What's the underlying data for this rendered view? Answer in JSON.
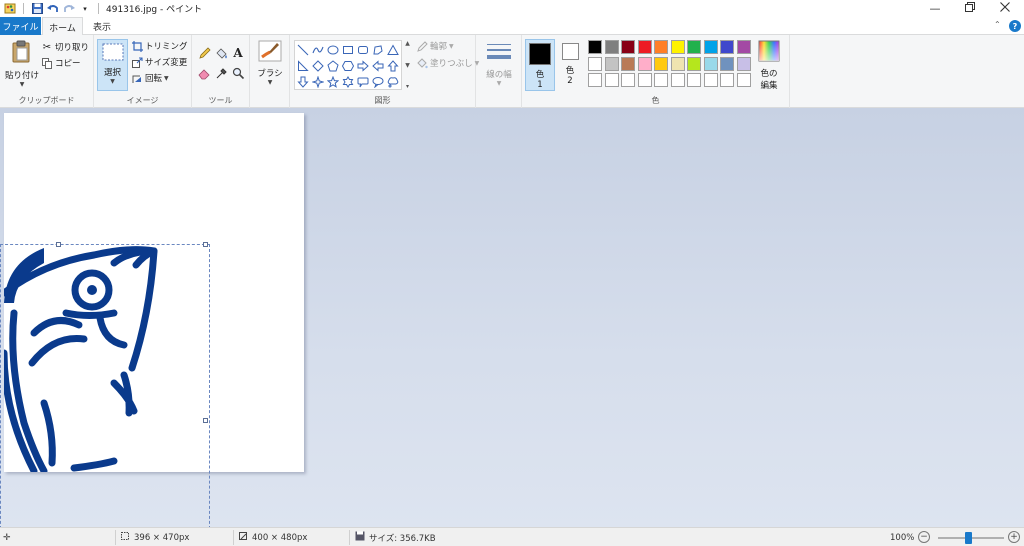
{
  "window": {
    "title": "491316.jpg - ペイント",
    "controls": {
      "minimize_icon": "minimize-icon",
      "restore_icon": "restore-icon",
      "close_icon": "close-icon"
    }
  },
  "tabs": [
    {
      "label": "ファイル",
      "selected": false
    },
    {
      "label": "ホーム",
      "selected": true
    },
    {
      "label": "表示",
      "selected": false
    }
  ],
  "ribbon": {
    "clipboard": {
      "paste": "貼り付け",
      "cut": "切り取り",
      "copy": "コピー",
      "label": "クリップボード"
    },
    "image": {
      "select": "選択",
      "crop": "トリミング",
      "resize": "サイズ変更",
      "rotate": "回転",
      "label": "イメージ"
    },
    "tools": {
      "label": "ツール"
    },
    "brush": {
      "label": "ブラシ"
    },
    "shapes": {
      "outline": "輪郭",
      "fill": "塗りつぶし",
      "label": "図形"
    },
    "size": {
      "label": "線の幅"
    },
    "colors": {
      "color1": "色",
      "color1_num": "1",
      "color2": "色",
      "color2_num": "2",
      "edit_line1": "色の",
      "edit_line2": "編集",
      "label": "色",
      "color1_value": "#000000",
      "color2_value": "#ffffff",
      "palette_row1": [
        "#000000",
        "#7f7f7f",
        "#880015",
        "#ed1c24",
        "#ff7f27",
        "#fff200",
        "#22b14c",
        "#00a2e8",
        "#3f48cc",
        "#a349a4"
      ],
      "palette_row2": [
        "#ffffff",
        "#c3c3c3",
        "#b97a57",
        "#ffaec9",
        "#ffc90e",
        "#efe4b0",
        "#b5e61d",
        "#99d9ea",
        "#7092be",
        "#c8bfe7"
      ],
      "palette_row3": [
        "#ffffff",
        "#ffffff",
        "#ffffff",
        "#ffffff",
        "#ffffff",
        "#ffffff",
        "#ffffff",
        "#ffffff",
        "#ffffff",
        "#ffffff"
      ]
    }
  },
  "canvas": {
    "artwork_color": "#0a3a8c"
  },
  "status": {
    "selection_size": "396 × 470px",
    "image_size": "400 × 480px",
    "file_size": "サイズ: 356.7KB",
    "zoom": "100%"
  }
}
